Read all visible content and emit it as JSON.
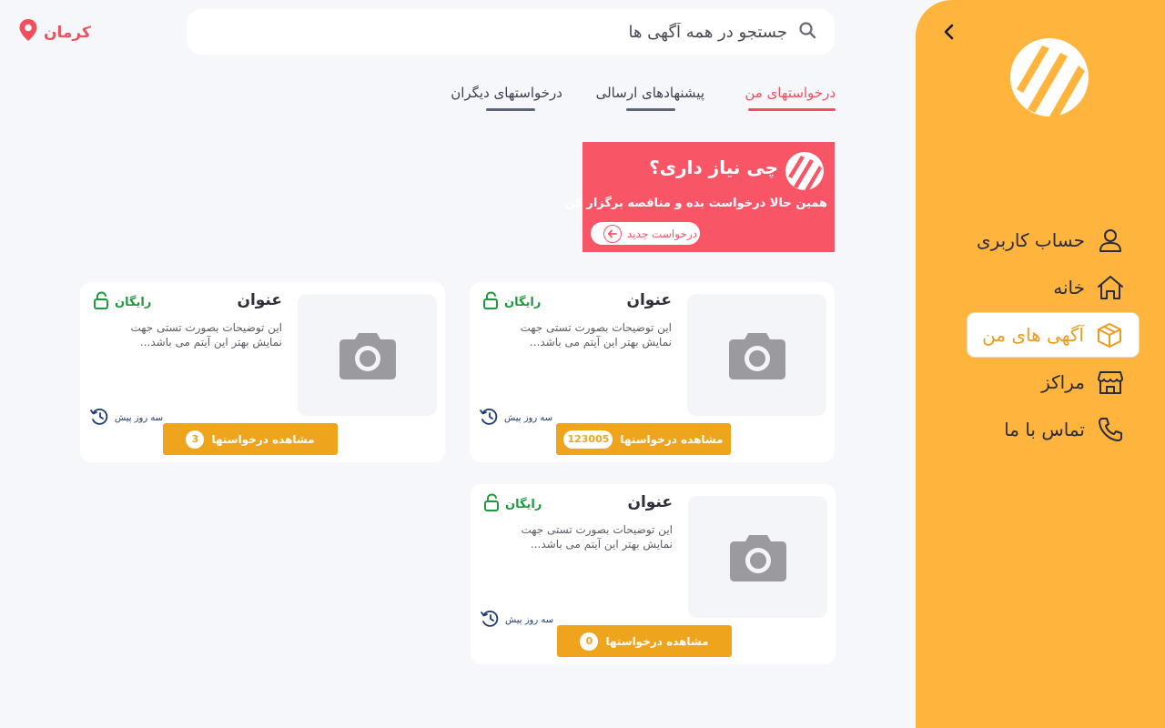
{
  "search": {
    "placeholder": "جستجو در همه آگهی ها"
  },
  "location": {
    "city": "کرمان"
  },
  "sidebar": {
    "items": [
      {
        "label": "حساب کاربری",
        "icon": "user-icon"
      },
      {
        "label": "خانه",
        "icon": "home-icon"
      },
      {
        "label": "آگهی های من",
        "icon": "box-icon",
        "active": true
      },
      {
        "label": "مراکز",
        "icon": "store-icon"
      },
      {
        "label": "تماس با ما",
        "icon": "phone-icon"
      }
    ]
  },
  "tabs": [
    {
      "label": "درخواستهای من",
      "active": true
    },
    {
      "label": "پیشنهادهای ارسالی"
    },
    {
      "label": "درخواستهای دیگران"
    }
  ],
  "banner": {
    "title": "چی نیاز داری؟",
    "subtitle": "همین حالا درخواست بده و مناقصه برگزار کن",
    "button": "درخواست جدید"
  },
  "cards": [
    {
      "title": "عنوان",
      "price": "رایگان",
      "desc_line1": "این توضیحات بصورت تستی جهت",
      "desc_line2": "نمایش بهتر این  آیتم می باشد...",
      "time": "سه روز پیش",
      "button": "مشاهده درخواستها",
      "count": "123005"
    },
    {
      "title": "عنوان",
      "price": "رایگان",
      "desc_line1": "این توضیحات بصورت تستی جهت",
      "desc_line2": "نمایش بهتر این  آیتم می باشد...",
      "time": "سه روز پیش",
      "button": "مشاهده درخواستها",
      "count": "3"
    },
    {
      "title": "عنوان",
      "price": "رایگان",
      "desc_line1": "این توضیحات بصورت تستی جهت",
      "desc_line2": "نمایش بهتر این  آیتم می باشد...",
      "time": "سه روز پیش",
      "button": "مشاهده درخواستها",
      "count": "0"
    }
  ],
  "colors": {
    "sidebar": "#ffb43e",
    "accent_red": "#f85566",
    "button_orange": "#efa41e",
    "free_green": "#1c9a3c"
  }
}
